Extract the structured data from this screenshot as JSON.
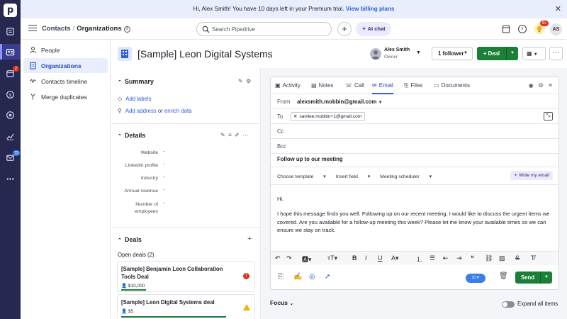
{
  "banner": {
    "message": "Hi, Alex Smith! You have 10 days left in your Premium trial.",
    "link": "View billing plans",
    "close": "✕"
  },
  "rail": {
    "logo": "p",
    "badges": {
      "deals": "2",
      "mail": "73"
    }
  },
  "header": {
    "breadcrumb": [
      "Contacts",
      "Organizations"
    ],
    "separator": "/",
    "search_placeholder": "Search Pipedrive",
    "ai_chat": "AI chat",
    "notifications_badge": "9+",
    "avatar_initials": "AS"
  },
  "subnav": {
    "items": [
      {
        "label": "People",
        "icon": "person-icon"
      },
      {
        "label": "Organizations",
        "icon": "building-icon"
      },
      {
        "label": "Contacts timeline",
        "icon": "timeline-icon"
      },
      {
        "label": "Merge duplicates",
        "icon": "merge-icon"
      }
    ]
  },
  "org": {
    "title": "[Sample] Leon Digital Systems",
    "owner_name": "Alex Smith",
    "owner_role": "Owner",
    "follower_label": "1 follower",
    "deal_label": "+ Deal"
  },
  "summary": {
    "heading": "Summary",
    "add_labels": "Add labels",
    "add_address": "Add address",
    "or": "or",
    "enrich": "enrich data"
  },
  "details": {
    "heading": "Details",
    "fields": [
      {
        "label": "Website",
        "value": "-"
      },
      {
        "label": "LinkedIn profile",
        "value": "-"
      },
      {
        "label": "Industry",
        "value": "-"
      },
      {
        "label": "Annual revenue",
        "value": "-"
      },
      {
        "label": "Number of\nemployees",
        "value": "-"
      }
    ]
  },
  "deals": {
    "heading": "Deals",
    "open_deals": "Open deals (2)",
    "items": [
      {
        "name": "[Sample] Benjamin Leon Collaboration Tools Deal",
        "amount": "$10,000",
        "status": "!"
      },
      {
        "name": "[Sample] Leon Digital Systems deal",
        "amount": "$5"
      }
    ]
  },
  "email": {
    "tabs": [
      {
        "label": "Activity",
        "icon": "calendar-icon"
      },
      {
        "label": "Notes",
        "icon": "note-icon"
      },
      {
        "label": "Call",
        "icon": "phone-icon"
      },
      {
        "label": "Email",
        "icon": "envelope-icon"
      },
      {
        "label": "Files",
        "icon": "paperclip-icon"
      },
      {
        "label": "Documents",
        "icon": "document-icon"
      }
    ],
    "from_label": "From",
    "from_value": "alexsmith.mobbin@gmail.com",
    "to_label": "To",
    "to_chip": "samlee.mobbin+1@gmail.com",
    "cc_label": "Cc",
    "bcc_label": "Bcc",
    "subject": "Follow up to our meeting",
    "choose_template": "Choose template",
    "insert_field": "Insert field",
    "meeting_scheduler": "Meeting scheduler",
    "write_ai": "Write my email",
    "greeting": "Hi,",
    "body": "I hope this message finds you well. Following up on our recent meeting, I would like to discuss the urgent items we covered. Are you available for a follow-up meeting this week? Please let me know your available times so we can ensure we stay on track.",
    "send": "Send"
  },
  "focus": {
    "label": "Focus",
    "expand_all": "Expand all items"
  }
}
